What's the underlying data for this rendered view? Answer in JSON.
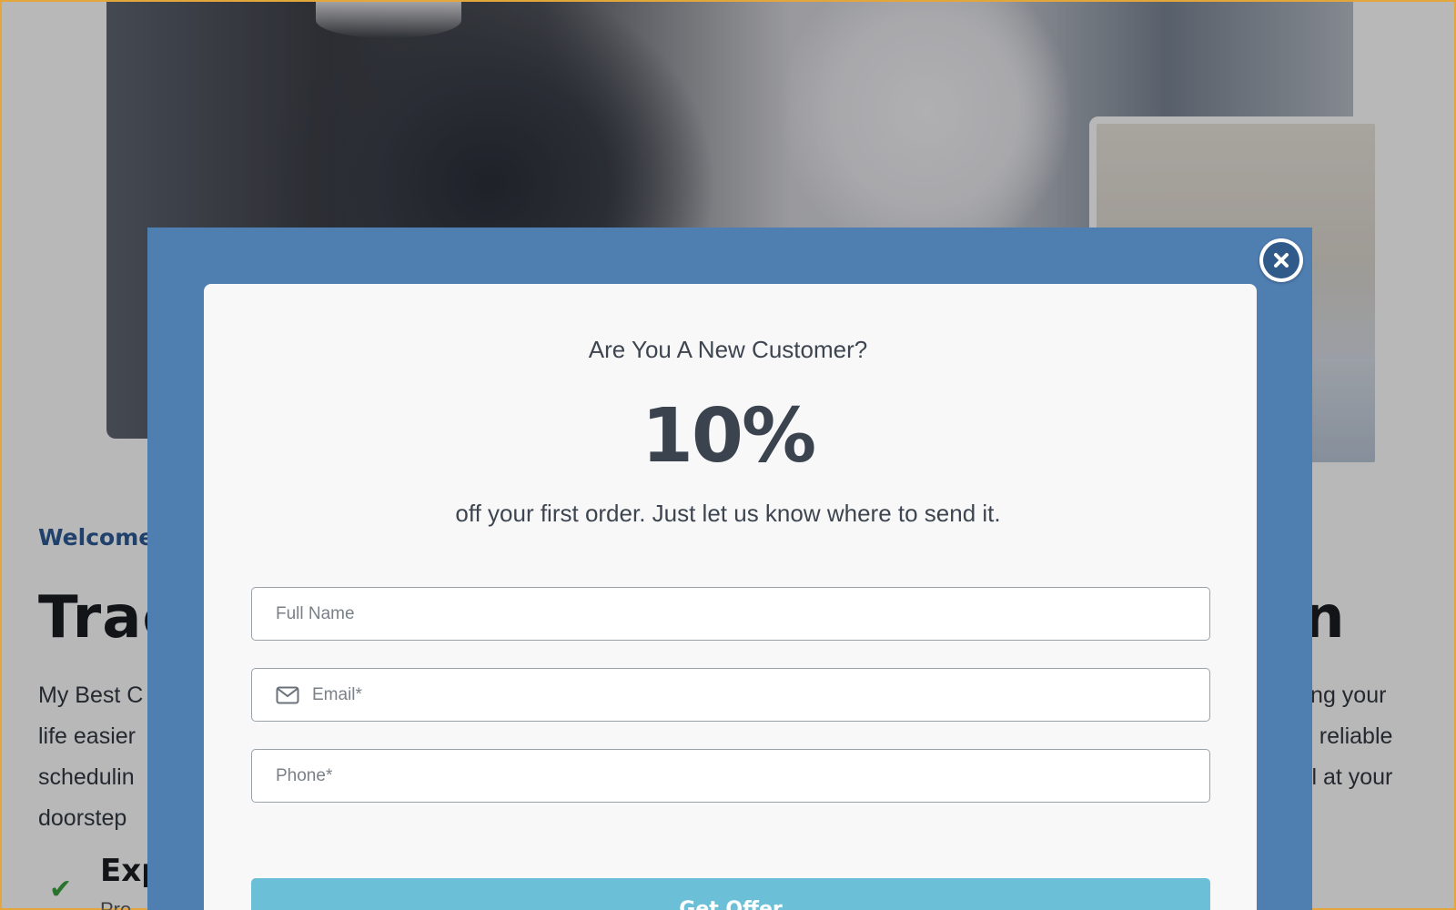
{
  "background_page": {
    "welcome_text": "Welcome",
    "heading_left": "Trac",
    "heading_right": "n",
    "intro_left": [
      "My Best C",
      "life easier",
      "schedulin",
      "doorstep"
    ],
    "intro_right": [
      "king your",
      "g, reliable",
      "ail at your"
    ],
    "feature_title": "Exp",
    "feature_sub": "Pro",
    "check_icon": "check-icon"
  },
  "modal": {
    "eyebrow": "Are You A New Customer?",
    "discount": "10%",
    "subtext": "off your first order. Just let us know where to send it.",
    "fields": {
      "full_name_placeholder": "Full Name",
      "email_placeholder": "Email*",
      "phone_placeholder": "Phone*"
    },
    "submit_label": "Get Offer",
    "close_icon": "close-icon",
    "email_icon": "mail-icon"
  },
  "colors": {
    "modal_frame": "#4f7eb1",
    "submit_button": "#6bbfd6",
    "welcome_accent": "#2d5a96",
    "check_green": "#38a13f"
  }
}
